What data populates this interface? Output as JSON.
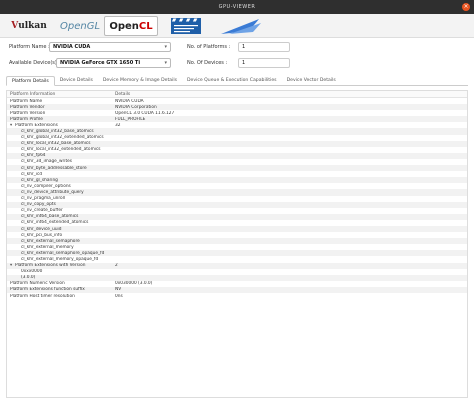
{
  "window": {
    "title": "GPU-VIEWER",
    "close_glyph": "×"
  },
  "logos": [
    {
      "name": "vulkan-logo",
      "text_a": "V",
      "text_b": "ulkan"
    },
    {
      "name": "opengl-logo",
      "text": "OpenGL"
    },
    {
      "name": "opencl-logo",
      "text_a": "Open",
      "text_b": "CL"
    }
  ],
  "form": {
    "platform_name_label": "Platform Name :",
    "platform_name_value": "NVIDIA CUDA",
    "available_devices_label": "Available Device(s) :",
    "available_devices_value": "NVIDIA GeForce GTX 1650 Ti",
    "no_platforms_label": "No. of Platforms :",
    "no_platforms_value": "1",
    "no_devices_label": "No. Of Devices :",
    "no_devices_value": "1"
  },
  "tabs": [
    "Platform Details",
    "Device Details",
    "Device Memory & Image Details",
    "Device Queue & Execution Capabilities",
    "Device Vector Details"
  ],
  "table": {
    "headers": [
      "Platform Information",
      "Details"
    ],
    "rows": [
      {
        "key": "Platform Name",
        "value": "NVIDIA CUDA",
        "indent": false,
        "toggle": ""
      },
      {
        "key": "Platform Vendor",
        "value": "NVIDIA Corporation",
        "indent": false,
        "toggle": ""
      },
      {
        "key": "Platform Version",
        "value": "OpenCL 3.0 CUDA 11.6.127",
        "indent": false,
        "toggle": ""
      },
      {
        "key": "Platform Profile",
        "value": "FULL_PROFILE",
        "indent": false,
        "toggle": ""
      },
      {
        "key": "Platform Extensions",
        "value": "32",
        "indent": false,
        "toggle": "▾"
      },
      {
        "key": "cl_khr_global_int32_base_atomics",
        "value": "",
        "indent": true,
        "toggle": ""
      },
      {
        "key": "cl_khr_global_int32_extended_atomics",
        "value": "",
        "indent": true,
        "toggle": ""
      },
      {
        "key": "cl_khr_local_int32_base_atomics",
        "value": "",
        "indent": true,
        "toggle": ""
      },
      {
        "key": "cl_khr_local_int32_extended_atomics",
        "value": "",
        "indent": true,
        "toggle": ""
      },
      {
        "key": "cl_khr_fp64",
        "value": "",
        "indent": true,
        "toggle": ""
      },
      {
        "key": "cl_khr_3d_image_writes",
        "value": "",
        "indent": true,
        "toggle": ""
      },
      {
        "key": "cl_khr_byte_addressable_store",
        "value": "",
        "indent": true,
        "toggle": ""
      },
      {
        "key": "cl_khr_icd",
        "value": "",
        "indent": true,
        "toggle": ""
      },
      {
        "key": "cl_khr_gl_sharing",
        "value": "",
        "indent": true,
        "toggle": ""
      },
      {
        "key": "cl_nv_compiler_options",
        "value": "",
        "indent": true,
        "toggle": ""
      },
      {
        "key": "cl_nv_device_attribute_query",
        "value": "",
        "indent": true,
        "toggle": ""
      },
      {
        "key": "cl_nv_pragma_unroll",
        "value": "",
        "indent": true,
        "toggle": ""
      },
      {
        "key": "cl_nv_copy_opts",
        "value": "",
        "indent": true,
        "toggle": ""
      },
      {
        "key": "cl_nv_create_buffer",
        "value": "",
        "indent": true,
        "toggle": ""
      },
      {
        "key": "cl_khr_int64_base_atomics",
        "value": "",
        "indent": true,
        "toggle": ""
      },
      {
        "key": "cl_khr_int64_extended_atomics",
        "value": "",
        "indent": true,
        "toggle": ""
      },
      {
        "key": "cl_khr_device_uuid",
        "value": "",
        "indent": true,
        "toggle": ""
      },
      {
        "key": "cl_khr_pci_bus_info",
        "value": "",
        "indent": true,
        "toggle": ""
      },
      {
        "key": "cl_khr_external_semaphore",
        "value": "",
        "indent": true,
        "toggle": ""
      },
      {
        "key": "cl_khr_external_memory",
        "value": "",
        "indent": true,
        "toggle": ""
      },
      {
        "key": "cl_khr_external_semaphore_opaque_fd",
        "value": "",
        "indent": true,
        "toggle": ""
      },
      {
        "key": "cl_khr_external_memory_opaque_fd",
        "value": "",
        "indent": true,
        "toggle": ""
      },
      {
        "key": "Platform Extensions with Version",
        "value": "2",
        "indent": false,
        "toggle": "▾"
      },
      {
        "key": "0xxx0000",
        "value": "",
        "indent": true,
        "toggle": ""
      },
      {
        "key": "(3.0.0)",
        "value": "",
        "indent": true,
        "toggle": ""
      },
      {
        "key": "Platform Numeric Version",
        "value": "0x030000 (3.0.0)",
        "indent": false,
        "toggle": ""
      },
      {
        "key": "Platform Extensions function suffix",
        "value": "NV",
        "indent": false,
        "toggle": ""
      },
      {
        "key": "Platform Host timer resolution",
        "value": "0ns",
        "indent": false,
        "toggle": ""
      }
    ]
  }
}
